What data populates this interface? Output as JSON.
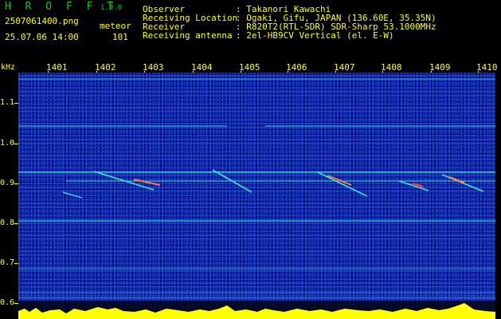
{
  "app": {
    "logo": "H R O F F T",
    "version": "1.0.0",
    "filename": "2507061400.png",
    "mode": "meteor",
    "datetime": "25.07.06 14:00",
    "count": "101"
  },
  "info": {
    "observer_label": "Observer",
    "observer_value": ": Takanori Kawachi",
    "location_label": "Receiving Location",
    "location_value": ": Ogaki, Gifu, JAPAN (136.60E, 35.35N)",
    "receiver_label": "Receiver",
    "receiver_value": ": R820T2(RTL-SDR) SDR-Sharp 53.1000MHz",
    "antenna_label": "Receiving antenna",
    "antenna_value": ": 2el-HB9CV Vertical (el. E-W)"
  },
  "axis": {
    "y_unit": "kHz",
    "x_ticks": [
      "1401",
      "1402",
      "1403",
      "1404",
      "1405",
      "1406",
      "1407",
      "1408",
      "1409",
      "1410"
    ],
    "y_ticks": [
      "1.1",
      "1.0",
      "0.9",
      "0.8",
      "0.7",
      "0.6"
    ]
  },
  "colors": {
    "background": "#000000",
    "text_yellow": "#ffff00",
    "logo_green": "#00d200",
    "spectrum_blue": "#0a1ea0",
    "signal_cyan": "#40e0e0"
  }
}
